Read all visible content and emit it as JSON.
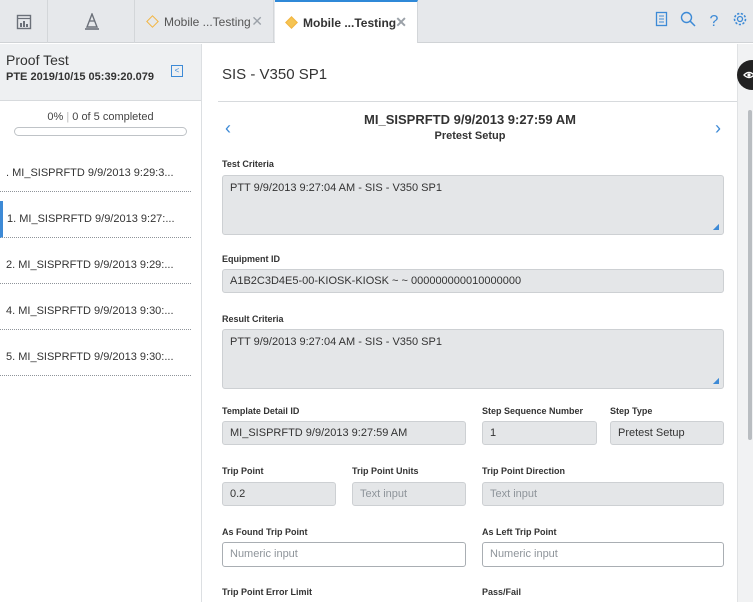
{
  "topbar": {
    "tabs": [
      {
        "label": "Mobile ...Testing",
        "active": false
      },
      {
        "label": "Mobile ...Testing",
        "active": true
      }
    ],
    "icons": [
      "dashboard-icon",
      "cone-icon",
      "notes-icon",
      "search-icon",
      "help-icon",
      "gear-icon"
    ],
    "help_glyph": "?"
  },
  "left": {
    "title": "Proof Test",
    "subtitle": "PTE 2019/10/15 05:39:20.079",
    "progress": {
      "percent_label": "0%",
      "count_label": "0 of 5 completed",
      "fraction": 0
    },
    "items": [
      {
        "label": ". MI_SISPRFTD 9/9/2013 9:29:3...",
        "active": false
      },
      {
        "label": "1. MI_SISPRFTD 9/9/2013 9:27:...",
        "active": true
      },
      {
        "label": "2. MI_SISPRFTD 9/9/2013 9:29:...",
        "active": false
      },
      {
        "label": "4. MI_SISPRFTD 9/9/2013 9:30:...",
        "active": false
      },
      {
        "label": "5. MI_SISPRFTD 9/9/2013 9:30:...",
        "active": false
      }
    ]
  },
  "main": {
    "title": "SIS - V350 SP1",
    "step_title": "MI_SISPRFTD 9/9/2013 9:27:59 AM",
    "step_subtitle": "Pretest Setup",
    "fields": {
      "test_criteria": {
        "label": "Test Criteria",
        "value": "PTT 9/9/2013 9:27:04 AM - SIS - V350 SP1"
      },
      "equipment_id": {
        "label": "Equipment ID",
        "value": "A1B2C3D4E5-00-KIOSK-KIOSK ~ ~ 000000000010000000"
      },
      "result_criteria": {
        "label": "Result Criteria",
        "value": "PTT 9/9/2013 9:27:04 AM - SIS - V350 SP1"
      },
      "template_detail_id": {
        "label": "Template Detail ID",
        "value": "MI_SISPRFTD 9/9/2013 9:27:59 AM"
      },
      "step_sequence_number": {
        "label": "Step Sequence Number",
        "value": "1"
      },
      "step_type": {
        "label": "Step Type",
        "value": "Pretest Setup"
      },
      "trip_point": {
        "label": "Trip Point",
        "value": "0.2"
      },
      "trip_point_units": {
        "label": "Trip Point Units",
        "placeholder": "Text input"
      },
      "trip_point_direction": {
        "label": "Trip Point Direction",
        "placeholder": "Text input"
      },
      "as_found_trip_point": {
        "label": "As Found Trip Point",
        "placeholder": "Numeric input"
      },
      "as_left_trip_point": {
        "label": "As Left Trip Point",
        "placeholder": "Numeric input"
      },
      "trip_point_error_limit": {
        "label": "Trip Point Error Limit"
      },
      "pass_fail": {
        "label": "Pass/Fail"
      }
    }
  },
  "colors": {
    "accent": "#3d8ad6",
    "tab_icon": "#f2b441",
    "readonly_field": "#e4e6e8"
  }
}
